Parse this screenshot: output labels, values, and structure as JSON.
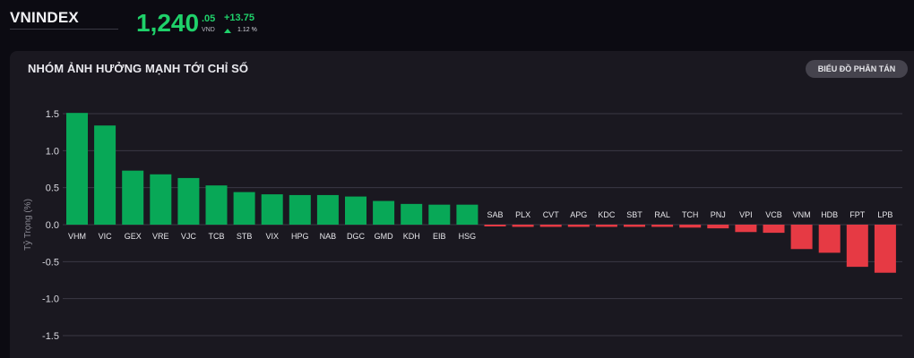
{
  "header": {
    "index_name": "VNINDEX",
    "price_main": "1,240",
    "price_decimal": ".05",
    "price_unit": "VND",
    "change": "+13.75",
    "change_pct": "1.12 %",
    "trend_icon": "up-arrow-icon",
    "colors": {
      "up": "#1fd16a"
    }
  },
  "panel": {
    "title": "NHÓM ẢNH HƯỞNG MẠNH TỚI CHỈ SỐ",
    "scatter_button_label": "BIỂU ĐỒ PHÂN TÁN"
  },
  "chart_data": {
    "type": "bar",
    "ylabel": "Tỷ Trọng (%)",
    "ylim": [
      -1.5,
      1.5
    ],
    "yticks": [
      1.5,
      1.0,
      0.5,
      0.0,
      -0.5,
      -1.0,
      -1.5
    ],
    "ytick_labels": [
      "1.5",
      "1.0",
      "0.5",
      "0.0",
      "-0.5",
      "-1.0",
      "-1.5"
    ],
    "grid": true,
    "categories": [
      "VHM",
      "VIC",
      "GEX",
      "VRE",
      "VJC",
      "TCB",
      "STB",
      "VIX",
      "HPG",
      "NAB",
      "DGC",
      "GMD",
      "KDH",
      "EIB",
      "HSG",
      "SAB",
      "PLX",
      "CVT",
      "APG",
      "KDC",
      "SBT",
      "RAL",
      "TCH",
      "PNJ",
      "VPI",
      "VCB",
      "VNM",
      "HDB",
      "FPT",
      "LPB"
    ],
    "values": [
      1.51,
      1.34,
      0.73,
      0.68,
      0.63,
      0.53,
      0.44,
      0.41,
      0.4,
      0.4,
      0.38,
      0.32,
      0.28,
      0.27,
      0.27,
      -0.02,
      -0.03,
      -0.03,
      -0.03,
      -0.03,
      -0.03,
      -0.03,
      -0.04,
      -0.05,
      -0.1,
      -0.11,
      -0.33,
      -0.38,
      -0.57,
      -0.65
    ],
    "colors": {
      "positive": "#08a857",
      "negative": "#e63a44",
      "grid": "#3a3944"
    }
  }
}
